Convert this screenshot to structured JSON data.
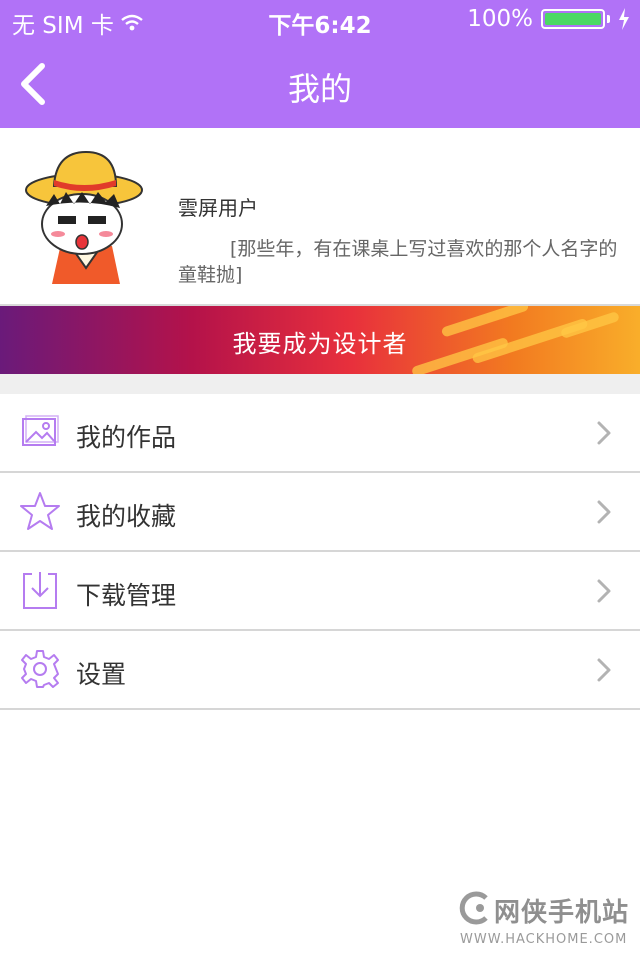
{
  "status_bar": {
    "carrier": "无 SIM 卡",
    "time": "下午6:42",
    "battery_percent": "100%",
    "battery_level": 1.0
  },
  "nav": {
    "title": "我的",
    "back_icon": "chevron-left-icon"
  },
  "profile": {
    "username": "雲屏用户",
    "signature": "[那些年，有在课桌上写过喜欢的那个人名字的童鞋抛]"
  },
  "banner": {
    "label": "我要成为设计者"
  },
  "menu": {
    "items": [
      {
        "label": "我的作品",
        "icon": "image-icon"
      },
      {
        "label": "我的收藏",
        "icon": "star-icon"
      },
      {
        "label": "下载管理",
        "icon": "download-icon"
      },
      {
        "label": "设置",
        "icon": "gear-icon"
      }
    ]
  },
  "watermark": {
    "name": "网侠手机站",
    "url": "WWW.HACKHOME.COM"
  },
  "colors": {
    "accent": "#b172f7",
    "icon": "#b57cf0"
  }
}
